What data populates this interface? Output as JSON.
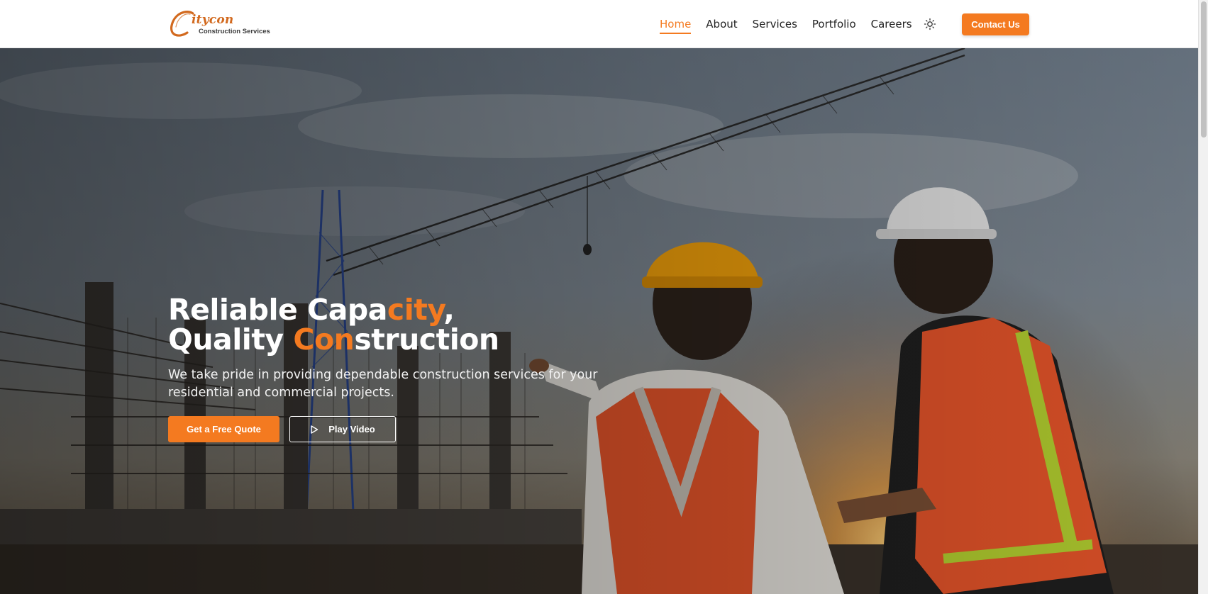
{
  "brand": {
    "name": "Citycon",
    "wordmark": "itycon",
    "tagline": "Construction Services"
  },
  "nav": {
    "items": [
      {
        "label": "Home",
        "active": true
      },
      {
        "label": "About",
        "active": false
      },
      {
        "label": "Services",
        "active": false
      },
      {
        "label": "Portfolio",
        "active": false
      },
      {
        "label": "Careers",
        "active": false
      }
    ],
    "theme_icon": "sun-icon",
    "contact_label": "Contact Us"
  },
  "hero": {
    "title_line1": {
      "before": "Reliable Capa",
      "accent": "city",
      "after": ","
    },
    "title_line2": {
      "before": "Quality ",
      "accent": "Con",
      "after": "struction"
    },
    "subtitle": "We take pride in providing dependable construction services for your residential and commercial projects.",
    "primary_cta": "Get a Free Quote",
    "secondary_cta": "Play Video",
    "secondary_icon": "play-icon"
  },
  "colors": {
    "accent": "#f47a20",
    "text_dark": "#222222",
    "white": "#ffffff"
  }
}
